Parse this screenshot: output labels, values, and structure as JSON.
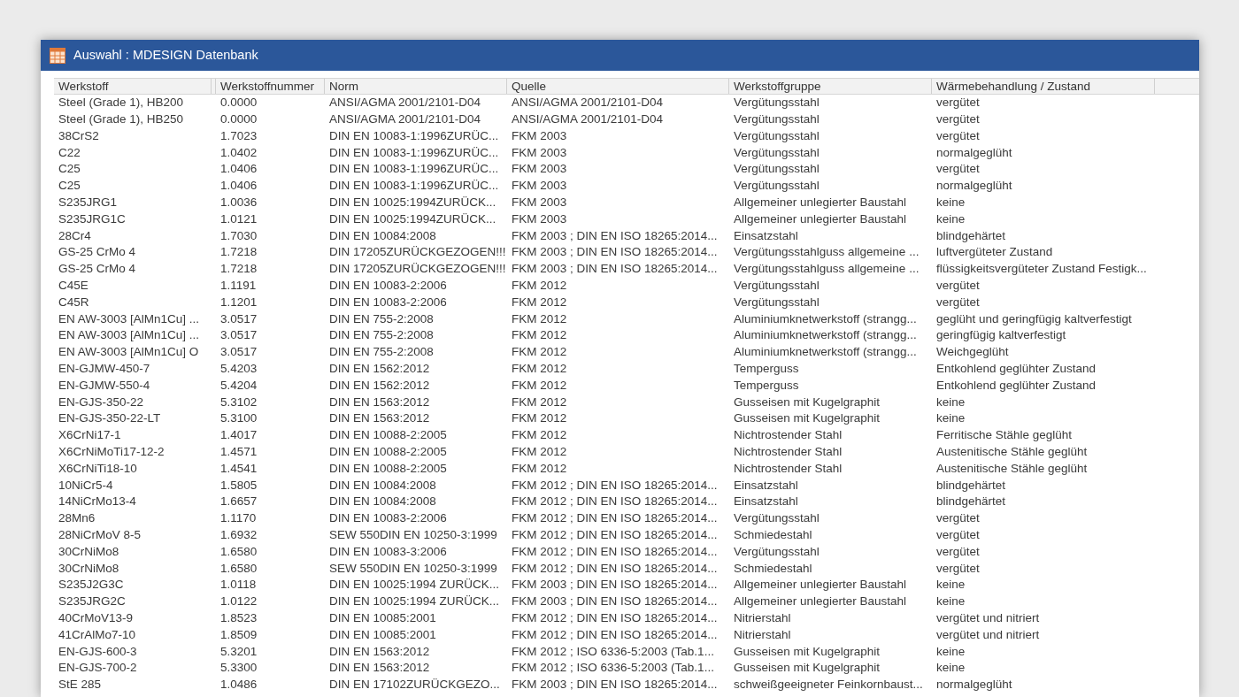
{
  "window": {
    "title": "Auswahl : MDESIGN Datenbank"
  },
  "table": {
    "columns": [
      "Werkstoff",
      "Werkstoffnummer",
      "Norm",
      "Quelle",
      "Werkstoffgruppe",
      "Wärmebehandlung / Zustand"
    ],
    "rows": [
      [
        "Steel (Grade 1), HB200",
        "0.0000",
        "ANSI/AGMA 2001/2101-D04",
        "ANSI/AGMA 2001/2101-D04",
        "Vergütungsstahl",
        "vergütet"
      ],
      [
        "Steel (Grade 1), HB250",
        "0.0000",
        "ANSI/AGMA 2001/2101-D04",
        "ANSI/AGMA 2001/2101-D04",
        "Vergütungsstahl",
        "vergütet"
      ],
      [
        "38CrS2",
        "1.7023",
        "DIN EN 10083-1:1996ZURÜC...",
        "FKM 2003",
        "Vergütungsstahl",
        "vergütet"
      ],
      [
        "C22",
        "1.0402",
        "DIN EN 10083-1:1996ZURÜC...",
        "FKM 2003",
        "Vergütungsstahl",
        "normalgeglüht"
      ],
      [
        "C25",
        "1.0406",
        "DIN EN 10083-1:1996ZURÜC...",
        "FKM 2003",
        "Vergütungsstahl",
        "vergütet"
      ],
      [
        "C25",
        "1.0406",
        "DIN EN 10083-1:1996ZURÜC...",
        "FKM 2003",
        "Vergütungsstahl",
        "normalgeglüht"
      ],
      [
        "S235JRG1",
        "1.0036",
        "DIN EN 10025:1994ZURÜCK...",
        "FKM 2003",
        "Allgemeiner unlegierter Baustahl",
        "keine"
      ],
      [
        "S235JRG1C",
        "1.0121",
        "DIN EN 10025:1994ZURÜCK...",
        "FKM 2003",
        "Allgemeiner unlegierter Baustahl",
        "keine"
      ],
      [
        "28Cr4",
        "1.7030",
        "DIN EN 10084:2008",
        "FKM 2003 ; DIN EN ISO 18265:2014...",
        "Einsatzstahl",
        "blindgehärtet"
      ],
      [
        "GS-25 CrMo 4",
        "1.7218",
        "DIN 17205ZURÜCKGEZOGEN!!!",
        "FKM 2003 ; DIN EN ISO 18265:2014...",
        "Vergütungsstahlguss allgemeine ...",
        "luftvergüteter Zustand"
      ],
      [
        "GS-25 CrMo 4",
        "1.7218",
        "DIN 17205ZURÜCKGEZOGEN!!!",
        "FKM 2003 ; DIN EN ISO 18265:2014...",
        "Vergütungsstahlguss allgemeine ...",
        "flüssigkeitsvergüteter Zustand Festigk..."
      ],
      [
        "C45E",
        "1.1191",
        "DIN EN 10083-2:2006",
        "FKM 2012",
        "Vergütungsstahl",
        "vergütet"
      ],
      [
        "C45R",
        "1.1201",
        "DIN EN 10083-2:2006",
        "FKM 2012",
        "Vergütungsstahl",
        "vergütet"
      ],
      [
        "EN AW-3003 [AlMn1Cu] ...",
        "3.0517",
        "DIN EN 755-2:2008",
        "FKM 2012",
        "Aluminiumknetwerkstoff (strangg...",
        "geglüht und geringfügig kaltverfestigt"
      ],
      [
        "EN AW-3003 [AlMn1Cu] ...",
        "3.0517",
        "DIN EN 755-2:2008",
        "FKM 2012",
        "Aluminiumknetwerkstoff (strangg...",
        "geringfügig kaltverfestigt"
      ],
      [
        "EN AW-3003 [AlMn1Cu] O",
        "3.0517",
        "DIN EN 755-2:2008",
        "FKM 2012",
        "Aluminiumknetwerkstoff (strangg...",
        "Weichgeglüht"
      ],
      [
        "EN-GJMW-450-7",
        "5.4203",
        "DIN EN 1562:2012",
        "FKM 2012",
        "Temperguss",
        "Entkohlend geglühter Zustand"
      ],
      [
        "EN-GJMW-550-4",
        "5.4204",
        "DIN EN 1562:2012",
        "FKM 2012",
        "Temperguss",
        "Entkohlend geglühter Zustand"
      ],
      [
        "EN-GJS-350-22",
        "5.3102",
        "DIN EN 1563:2012",
        "FKM 2012",
        "Gusseisen mit Kugelgraphit",
        "keine"
      ],
      [
        "EN-GJS-350-22-LT",
        "5.3100",
        "DIN EN 1563:2012",
        "FKM 2012",
        "Gusseisen mit Kugelgraphit",
        "keine"
      ],
      [
        "X6CrNi17-1",
        "1.4017",
        "DIN EN 10088-2:2005",
        "FKM 2012",
        "Nichtrostender Stahl",
        "Ferritische Stähle geglüht"
      ],
      [
        "X6CrNiMoTi17-12-2",
        "1.4571",
        "DIN EN 10088-2:2005",
        "FKM 2012",
        "Nichtrostender Stahl",
        "Austenitische Stähle geglüht"
      ],
      [
        "X6CrNiTi18-10",
        "1.4541",
        "DIN EN 10088-2:2005",
        "FKM 2012",
        "Nichtrostender Stahl",
        "Austenitische Stähle geglüht"
      ],
      [
        "10NiCr5-4",
        "1.5805",
        "DIN EN 10084:2008",
        "FKM 2012 ; DIN EN ISO 18265:2014...",
        "Einsatzstahl",
        "blindgehärtet"
      ],
      [
        "14NiCrMo13-4",
        "1.6657",
        "DIN EN 10084:2008",
        "FKM 2012 ; DIN EN ISO 18265:2014...",
        "Einsatzstahl",
        "blindgehärtet"
      ],
      [
        "28Mn6",
        "1.1170",
        "DIN EN 10083-2:2006",
        "FKM 2012 ; DIN EN ISO 18265:2014...",
        "Vergütungsstahl",
        "vergütet"
      ],
      [
        "28NiCrMoV 8-5",
        "1.6932",
        "SEW 550DIN EN 10250-3:1999",
        "FKM 2012 ; DIN EN ISO 18265:2014...",
        "Schmiedestahl",
        "vergütet"
      ],
      [
        "30CrNiMo8",
        "1.6580",
        "DIN EN 10083-3:2006",
        "FKM 2012 ; DIN EN ISO 18265:2014...",
        "Vergütungsstahl",
        "vergütet"
      ],
      [
        "30CrNiMo8",
        "1.6580",
        "SEW 550DIN EN 10250-3:1999",
        "FKM 2012 ; DIN EN ISO 18265:2014...",
        "Schmiedestahl",
        "vergütet"
      ],
      [
        "S235J2G3C",
        "1.0118",
        "DIN EN 10025:1994 ZURÜCK...",
        "FKM 2003 ; DIN EN ISO 18265:2014...",
        "Allgemeiner unlegierter Baustahl",
        "keine"
      ],
      [
        "S235JRG2C",
        "1.0122",
        "DIN EN 10025:1994 ZURÜCK...",
        "FKM 2003 ; DIN EN ISO 18265:2014...",
        "Allgemeiner unlegierter Baustahl",
        "keine"
      ],
      [
        "40CrMoV13-9",
        "1.8523",
        "DIN EN 10085:2001",
        "FKM 2012 ; DIN EN ISO 18265:2014...",
        "Nitrierstahl",
        "vergütet und nitriert"
      ],
      [
        "41CrAlMo7-10",
        "1.8509",
        "DIN EN 10085:2001",
        "FKM 2012 ; DIN EN ISO 18265:2014...",
        "Nitrierstahl",
        "vergütet und nitriert"
      ],
      [
        "EN-GJS-600-3",
        "5.3201",
        "DIN EN 1563:2012",
        "FKM 2012 ; ISO 6336-5:2003 (Tab.1...",
        "Gusseisen mit Kugelgraphit",
        "keine"
      ],
      [
        "EN-GJS-700-2",
        "5.3300",
        "DIN EN 1563:2012",
        "FKM 2012 ; ISO 6336-5:2003 (Tab.1...",
        "Gusseisen mit Kugelgraphit",
        "keine"
      ],
      [
        "StE 285",
        "1.0486",
        "DIN EN 17102ZURÜCKGEZO...",
        "FKM 2003 ; DIN EN ISO 18265:2014...",
        "schweißgeeigneter Feinkornbaust...",
        "normalgeglüht"
      ]
    ]
  }
}
